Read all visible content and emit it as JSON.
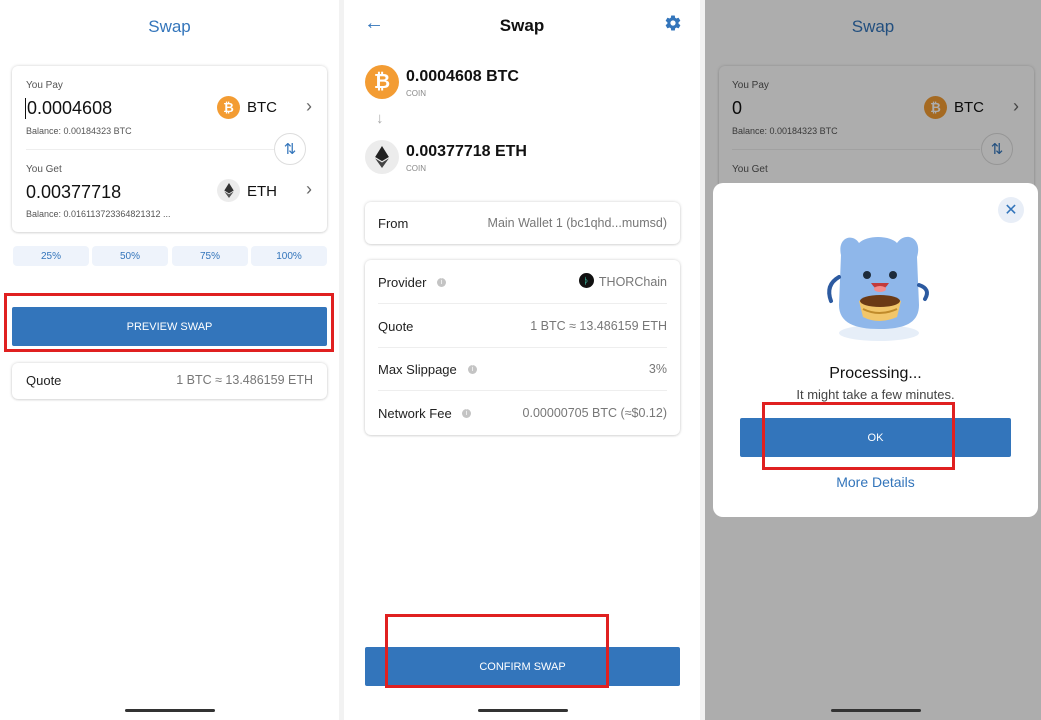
{
  "screen1": {
    "title": "Swap",
    "you_pay_label": "You Pay",
    "you_pay_amount": "0.0004608",
    "you_pay_coin": "BTC",
    "you_pay_balance": "Balance: 0.00184323 BTC",
    "you_get_label": "You Get",
    "you_get_amount": "0.00377718",
    "you_get_coin": "ETH",
    "you_get_balance": "Balance: 0.016113723364821312 ...",
    "percent_buttons": [
      "25%",
      "50%",
      "75%",
      "100%"
    ],
    "preview_button": "PREVIEW SWAP",
    "quote_label": "Quote",
    "quote_value": "1 BTC ≈ 13.486159 ETH"
  },
  "screen2": {
    "title": "Swap",
    "from_amount": "0.0004608 BTC",
    "from_type": "COIN",
    "to_amount": "0.00377718 ETH",
    "to_type": "COIN",
    "from_label": "From",
    "from_value": "Main Wallet 1  (bc1qhd...mumsd)",
    "provider_label": "Provider",
    "provider_value": "THORChain",
    "quote_label": "Quote",
    "quote_value": "1 BTC ≈ 13.486159 ETH",
    "slippage_label": "Max Slippage",
    "slippage_value": "3%",
    "fee_label": "Network Fee",
    "fee_value": "0.00000705 BTC (≈$0.12)",
    "confirm_button": "CONFIRM SWAP"
  },
  "screen3": {
    "title": "Swap",
    "you_pay_label": "You Pay",
    "you_pay_amount": "0",
    "you_pay_coin": "BTC",
    "you_pay_balance": "Balance: 0.00184323 BTC",
    "you_get_label": "You Get",
    "modal_title": "Processing...",
    "modal_subtitle": "It might take a few minutes.",
    "ok_button": "OK",
    "more_details": "More Details"
  },
  "colors": {
    "accent": "#3375bb",
    "btc": "#f39c33",
    "highlight": "#e02020"
  }
}
